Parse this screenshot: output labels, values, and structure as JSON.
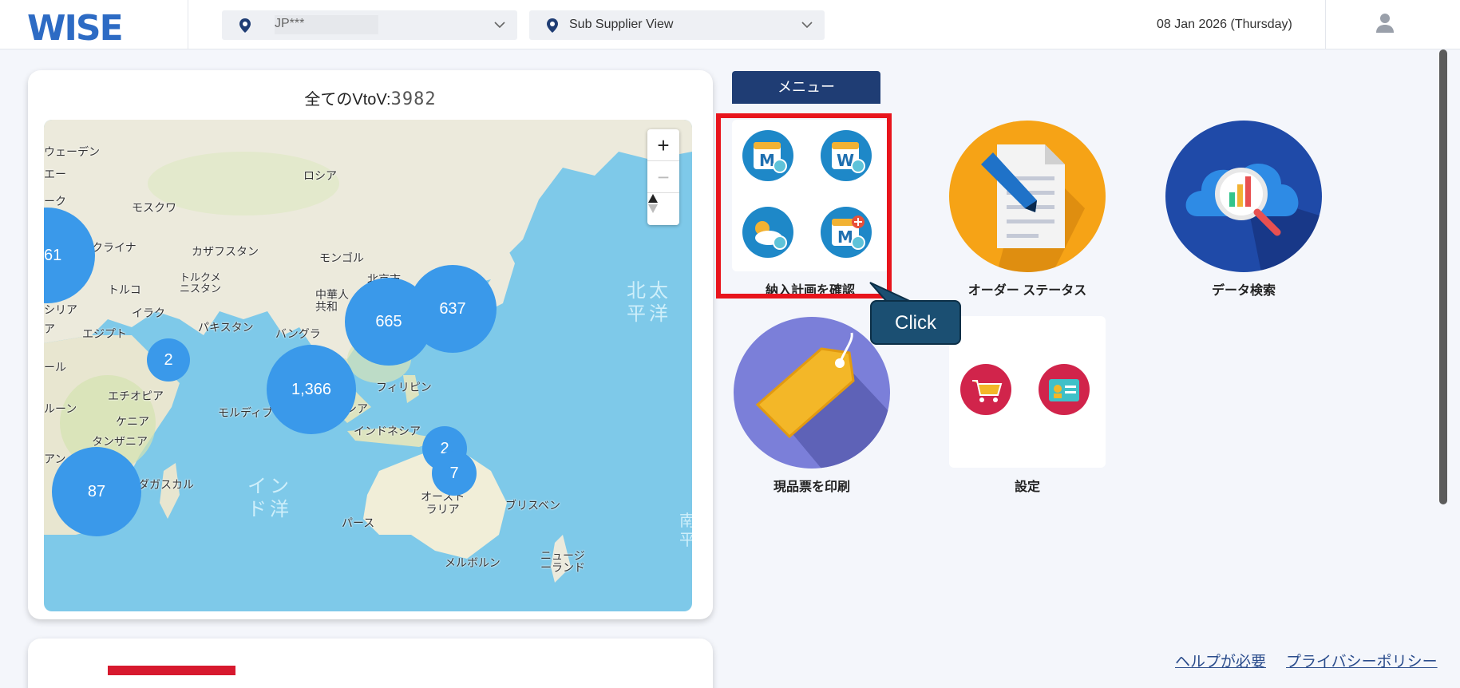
{
  "header": {
    "logo": "WISE",
    "location_dropdown": {
      "value": "JP***"
    },
    "view_dropdown": {
      "value": "Sub Supplier View"
    },
    "date": "08 Jan 2026 (Thursday)"
  },
  "map_card": {
    "title_prefix": "全てのVtoV:",
    "title_count": "3982",
    "zoom_in": "+",
    "zoom_out": "−",
    "compass": "▲▼",
    "labels": {
      "sweden": "ウェーデン",
      "finland": "エー",
      "denmark": "ーク",
      "moscow": "モスクワ",
      "russia": "ロシア",
      "ukraine": "クライナ",
      "kazakhstan": "カザフスタン",
      "mongolia": "モンゴル",
      "turkey": "トルコ",
      "turkmenistan": "トルクメ\nニスタン",
      "beijing": "北京市",
      "china": "中華人\n共和",
      "syria": "シリア",
      "iraq": "イラク",
      "a": "ア",
      "egypt": "エジプト",
      "pakistan": "パキスタン",
      "bangladesh": "バングラ",
      "sudan": "ール",
      "philippines": "フィリピン",
      "ethiopia": "エチオピア",
      "cameroon": "ルーン",
      "maldives": "モルディブ",
      "malaysia": "シア",
      "kenya": "ケニア",
      "indonesia": "インドネシア",
      "tanzania": "タンザニア",
      "angola": "アン",
      "madagascar": "ダガスカル",
      "australia": "オースト\nラリア",
      "brisbane": "ブリスベン",
      "perth": "パース",
      "melbourne": "メルボルン",
      "new_zealand": "ニュージ\nーランド",
      "indian_ocean": "イン\nド洋",
      "pacific": "北太\n平洋",
      "south": "南\n平"
    },
    "clusters": [
      {
        "count": "61"
      },
      {
        "count": "665"
      },
      {
        "count": "637"
      },
      {
        "count": "2"
      },
      {
        "count": "1,366"
      },
      {
        "count": "2"
      },
      {
        "count": "7"
      },
      {
        "count": "87"
      }
    ]
  },
  "menu": {
    "tab_label": "メニュー",
    "tiles": {
      "plan": "納入計画を確認",
      "order": "オーダー ステータス",
      "search": "データ検索",
      "print": "現品票を印刷",
      "settings": "設定"
    },
    "callout": "Click"
  },
  "footer": {
    "help": "ヘルプが必要",
    "privacy": "プライバシーポリシー"
  },
  "colors": {
    "brand_blue": "#2d6bc4",
    "menu_navy": "#1f3d74",
    "cluster": "#3a99ea",
    "highlight_red": "#e8141c",
    "callout": "#1b4f72"
  }
}
